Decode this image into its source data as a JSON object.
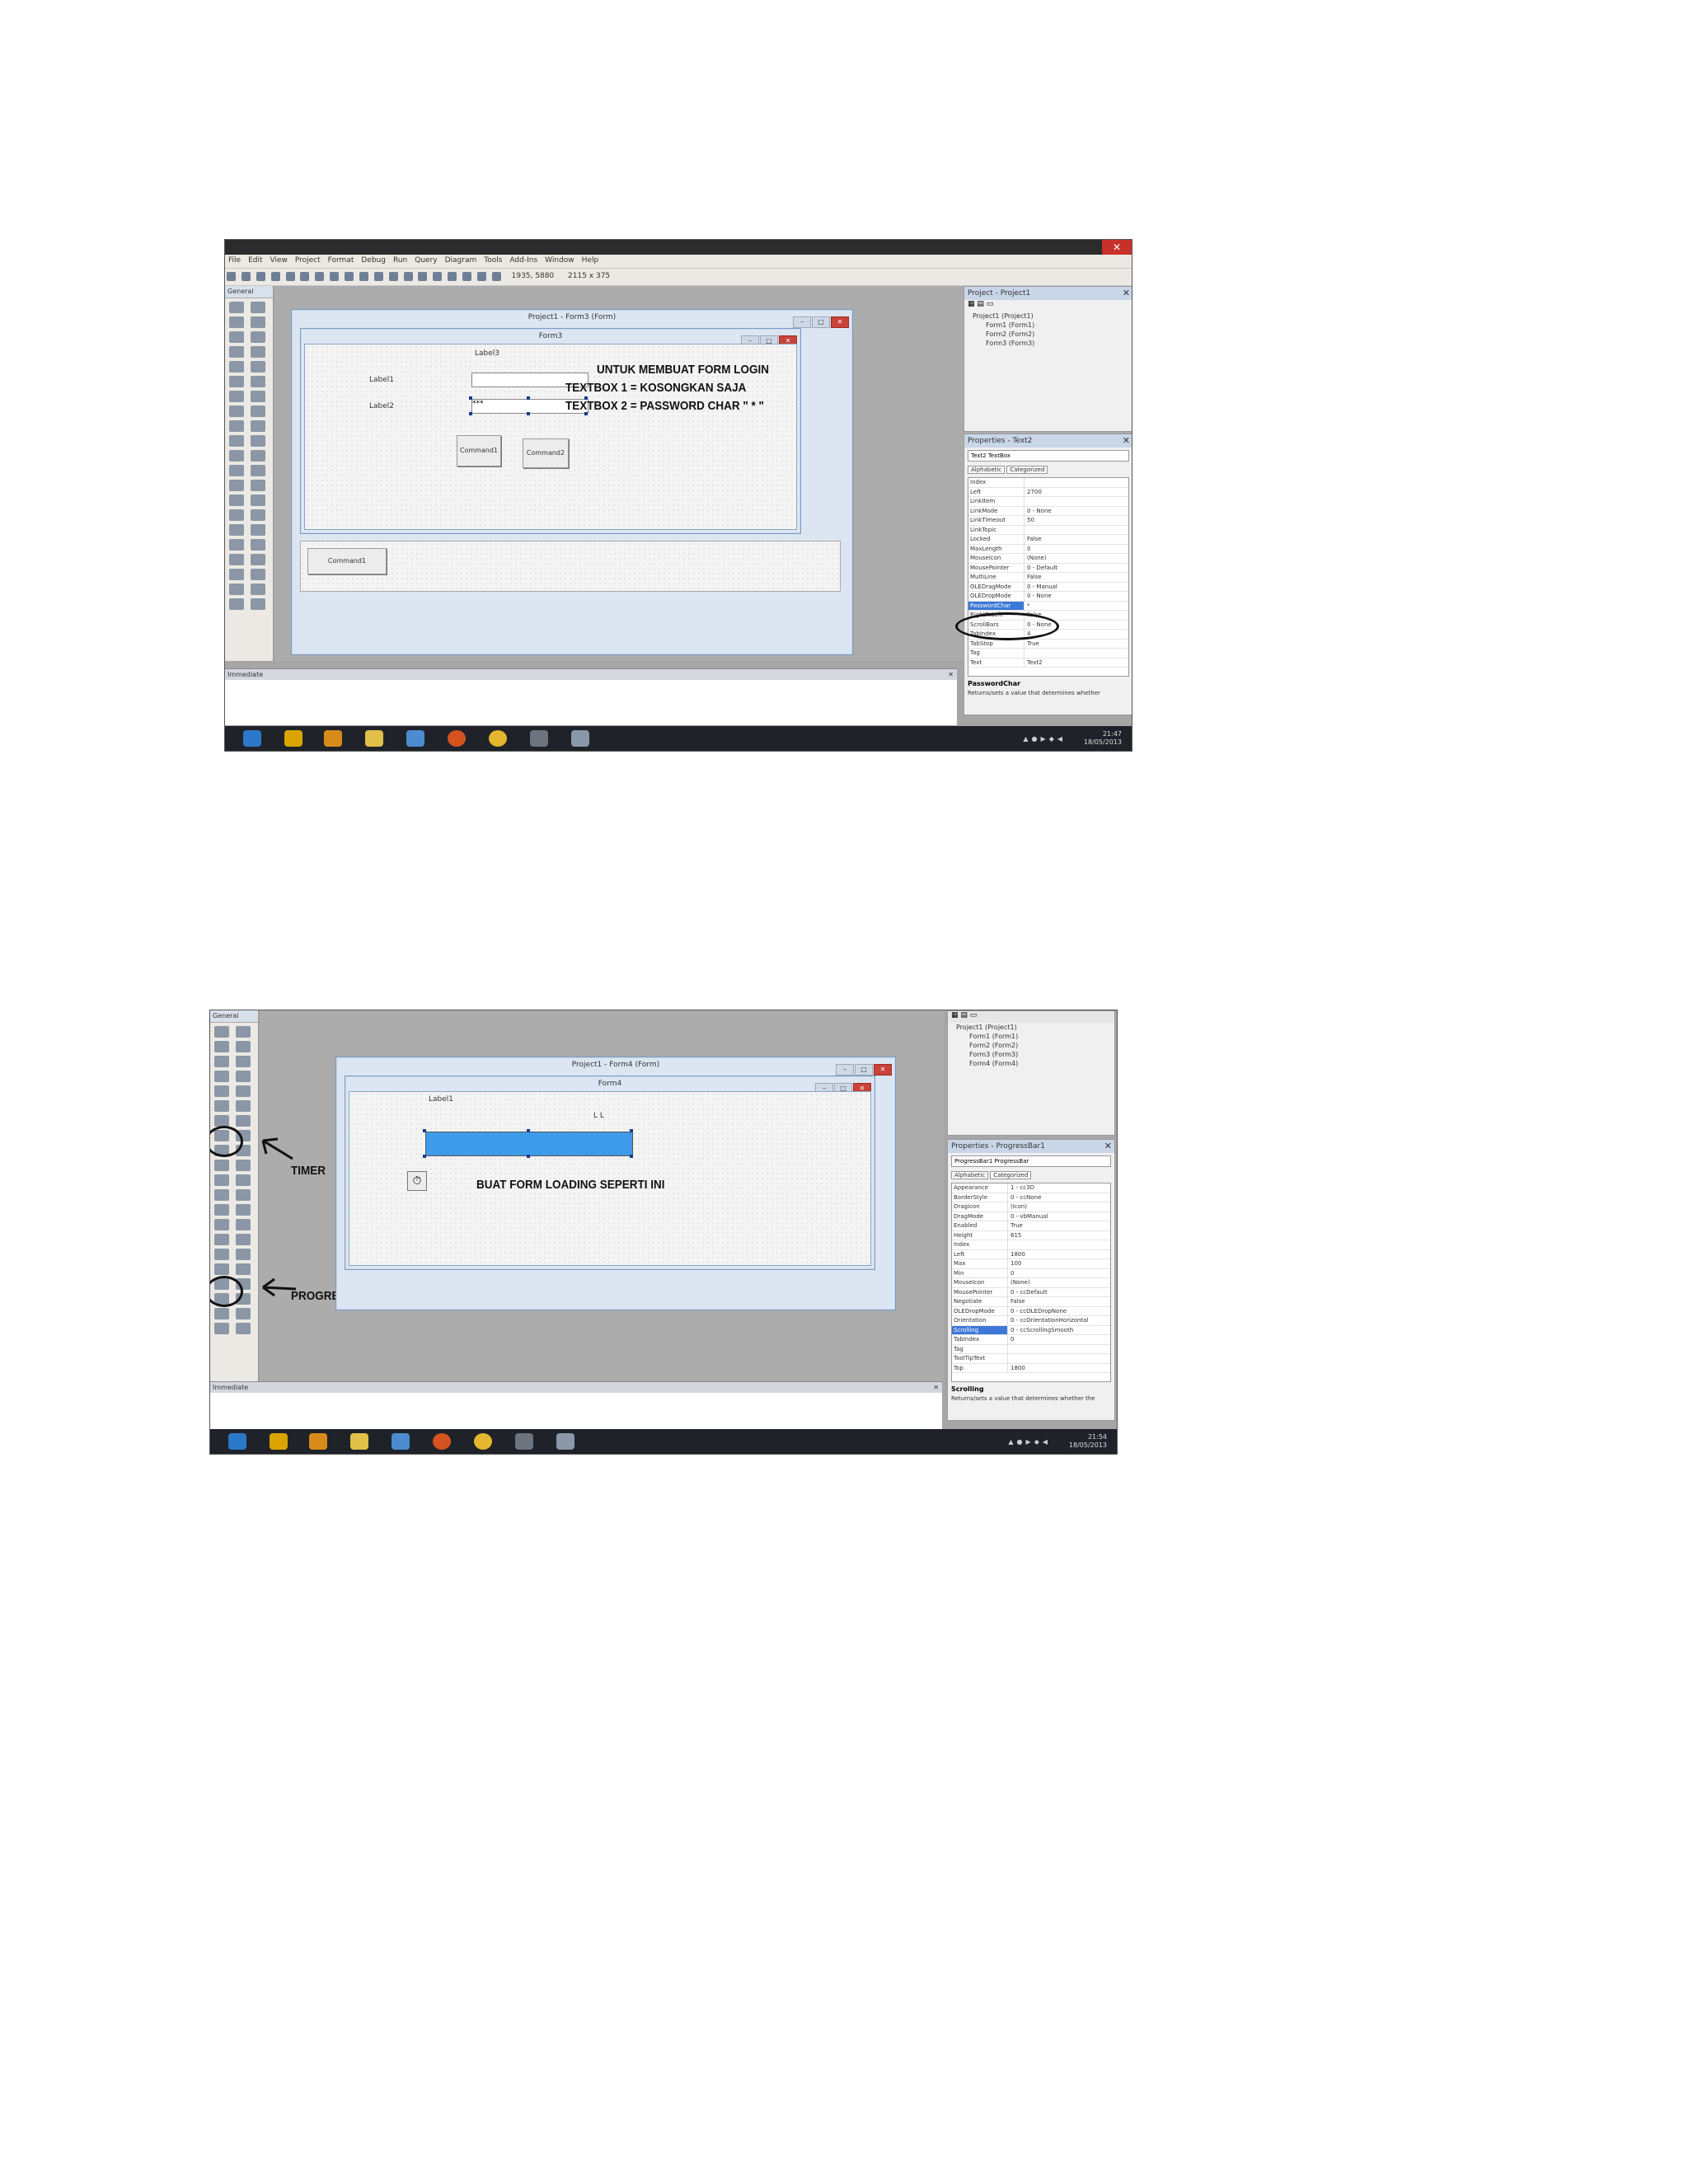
{
  "menu": [
    "File",
    "Edit",
    "View",
    "Project",
    "Format",
    "Debug",
    "Run",
    "Query",
    "Diagram",
    "Tools",
    "Add-Ins",
    "Window",
    "Help"
  ],
  "toolbar": {
    "coords1": "1935, 5880",
    "size1": "2115 x 375"
  },
  "toolbox": {
    "header": "General"
  },
  "screen1": {
    "mdi_title": "Project1 - Form3 (Form)",
    "form_title": "Form3",
    "label_top": "Label3",
    "label_a": "Label1",
    "label_b": "Label2",
    "text2_value": "***",
    "cmd1": "Command1",
    "cmd2": "Command2",
    "outer_cmd": "Command1",
    "annotation": [
      "UNTUK MEMBUAT FORM LOGIN",
      "TEXTBOX 1 = KOSONGKAN SAJA",
      "TEXTBOX 2 = PASSWORD CHAR \" * \""
    ],
    "project_title": "Project - Project1",
    "project_tree": [
      "Project1 (Project1)",
      "Form1 (Form1)",
      "Form2 (Form2)",
      "Form3 (Form3)"
    ],
    "props_title": "Properties - Text2",
    "props_object": "Text2 TextBox",
    "props_tabs": [
      "Alphabetic",
      "Categorized"
    ],
    "props": [
      [
        "Index",
        ""
      ],
      [
        "Left",
        "2700"
      ],
      [
        "LinkItem",
        ""
      ],
      [
        "LinkMode",
        "0 - None"
      ],
      [
        "LinkTimeout",
        "50"
      ],
      [
        "LinkTopic",
        ""
      ],
      [
        "Locked",
        "False"
      ],
      [
        "MaxLength",
        "0"
      ],
      [
        "MouseIcon",
        "(None)"
      ],
      [
        "MousePointer",
        "0 - Default"
      ],
      [
        "MultiLine",
        "False"
      ],
      [
        "OLEDragMode",
        "0 - Manual"
      ],
      [
        "OLEDropMode",
        "0 - None"
      ],
      [
        "PasswordChar",
        "*"
      ],
      [
        "RightToLeft",
        "False"
      ],
      [
        "ScrollBars",
        "0 - None"
      ],
      [
        "TabIndex",
        "4"
      ],
      [
        "TabStop",
        "True"
      ],
      [
        "Tag",
        ""
      ],
      [
        "Text",
        "Text2"
      ]
    ],
    "prop_selected_index": 13,
    "desc_title": "PasswordChar",
    "desc_text": "Returns/sets a value that determines whether",
    "immediate": "Immediate",
    "clock_time": "21:47",
    "clock_date": "18/05/2013"
  },
  "screen2": {
    "mdi_title": "Project1 - Form4 (Form)",
    "form_title": "Form4",
    "label_a": "Label1",
    "label_b": "L L",
    "annotation": "BUAT FORM LOADING SEPERTI INI",
    "label_timer": "TIMER",
    "label_progress": "PROGRESSBAR",
    "progress_value": 1.0,
    "project_tree": [
      "Project1 (Project1)",
      "Form1 (Form1)",
      "Form2 (Form2)",
      "Form3 (Form3)",
      "Form4 (Form4)"
    ],
    "props_title": "Properties - ProgressBar1",
    "props_object": "ProgressBar1 ProgressBar",
    "props_tabs": [
      "Alphabetic",
      "Categorized"
    ],
    "props": [
      [
        "Appearance",
        "1 - cc3D"
      ],
      [
        "BorderStyle",
        "0 - ccNone"
      ],
      [
        "DragIcon",
        "(Icon)"
      ],
      [
        "DragMode",
        "0 - vbManual"
      ],
      [
        "Enabled",
        "True"
      ],
      [
        "Height",
        "615"
      ],
      [
        "Index",
        ""
      ],
      [
        "Left",
        "1800"
      ],
      [
        "Max",
        "100"
      ],
      [
        "Min",
        "0"
      ],
      [
        "MouseIcon",
        "(None)"
      ],
      [
        "MousePointer",
        "0 - ccDefault"
      ],
      [
        "Negotiate",
        "False"
      ],
      [
        "OLEDropMode",
        "0 - ccOLEDropNone"
      ],
      [
        "Orientation",
        "0 - ccOrientationHorizontal"
      ],
      [
        "Scrolling",
        "0 - ccScrollingSmooth"
      ],
      [
        "TabIndex",
        "0"
      ],
      [
        "Tag",
        ""
      ],
      [
        "ToolTipText",
        ""
      ],
      [
        "Top",
        "1800"
      ]
    ],
    "prop_selected_index": 15,
    "desc_title": "Scrolling",
    "desc_text": "Returns/sets a value that determines whether the",
    "immediate": "Immediate",
    "clock_time": "21:54",
    "clock_date": "18/05/2013"
  },
  "colors": {
    "progress": "#3d9be9",
    "ide_bg": "#acacac",
    "taskbar": "#1f2329"
  }
}
